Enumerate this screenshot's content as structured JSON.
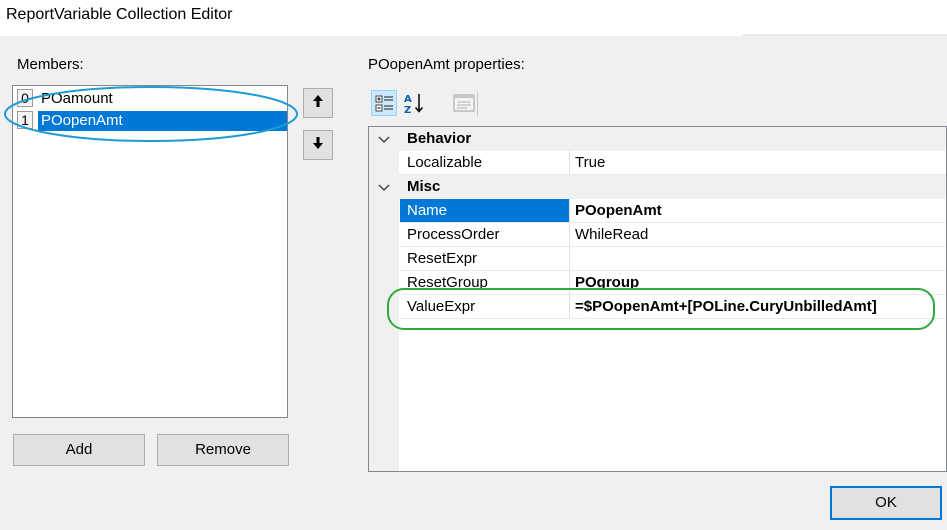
{
  "window": {
    "title": "ReportVariable Collection Editor"
  },
  "members": {
    "label": "Members:",
    "items": [
      {
        "index": "0",
        "name": "POamount"
      },
      {
        "index": "1",
        "name": "POopenAmt",
        "selected": true
      }
    ],
    "move_up_icon": "arrow-up-icon",
    "move_down_icon": "arrow-down-icon",
    "add_label": "Add",
    "remove_label": "Remove"
  },
  "properties": {
    "label": "POopenAmt properties:",
    "toolbar": {
      "categorized_icon": "categorized-icon",
      "alphabetical_icon": "alphabetical-sort-icon",
      "property_pages_icon": "property-pages-icon"
    },
    "categories": [
      {
        "name": "Behavior",
        "rows": [
          {
            "name": "Localizable",
            "value": "True",
            "bold": false
          }
        ]
      },
      {
        "name": "Misc",
        "rows": [
          {
            "name": "Name",
            "value": "POopenAmt",
            "bold": true,
            "selected": true
          },
          {
            "name": "ProcessOrder",
            "value": "WhileRead",
            "bold": false
          },
          {
            "name": "ResetExpr",
            "value": "",
            "bold": false
          },
          {
            "name": "ResetGroup",
            "value": "POgroup",
            "bold": true
          },
          {
            "name": "ValueExpr",
            "value": "=$POopenAmt+[POLine.CuryUnbilledAmt]",
            "bold": true
          }
        ]
      }
    ]
  },
  "footer": {
    "ok_label": "OK"
  },
  "colors": {
    "selection": "#0078d7",
    "annotation_blue": "#1e9bd7",
    "annotation_green": "#2eaa3e"
  }
}
